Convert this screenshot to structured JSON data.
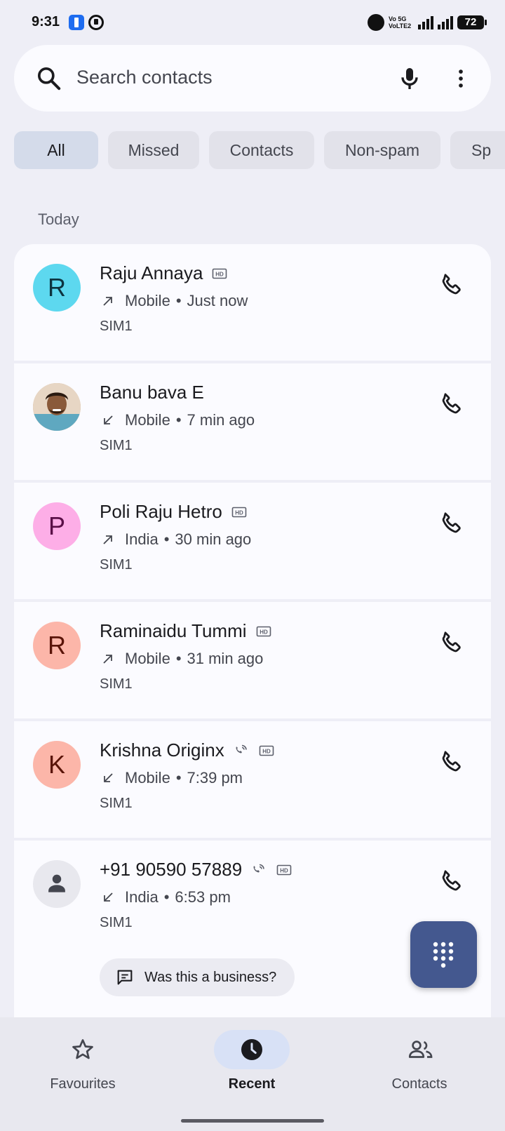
{
  "status_bar": {
    "time": "9:31",
    "network_label_top": "Vo 5G",
    "network_label_bottom": "VoLTE2",
    "battery": "72"
  },
  "search": {
    "placeholder": "Search contacts"
  },
  "filters": [
    {
      "label": "All",
      "active": true
    },
    {
      "label": "Missed",
      "active": false
    },
    {
      "label": "Contacts",
      "active": false
    },
    {
      "label": "Non-spam",
      "active": false
    },
    {
      "label": "Sp",
      "active": false
    }
  ],
  "section_title": "Today",
  "calls": [
    {
      "name": "Raju Annaya",
      "initial": "R",
      "avatar_color": "#5dd8ef",
      "initial_color": "#0d3440",
      "direction": "outgoing",
      "location": "Mobile",
      "time": "Just now",
      "sim": "SIM1",
      "hd": true,
      "wifi_call": false
    },
    {
      "name": "Banu bava E",
      "initial": "",
      "avatar_color": "#c9a27e",
      "initial_color": "#ffffff",
      "direction": "incoming",
      "location": "Mobile",
      "time": "7 min ago",
      "sim": "SIM1",
      "hd": false,
      "wifi_call": false,
      "photo": true
    },
    {
      "name": "Poli Raju Hetro",
      "initial": "P",
      "avatar_color": "#fdaee7",
      "initial_color": "#5a0f47",
      "direction": "outgoing",
      "location": "India",
      "time": "30 min ago",
      "sim": "SIM1",
      "hd": true,
      "wifi_call": false
    },
    {
      "name": "Raminaidu Tummi",
      "initial": "R",
      "avatar_color": "#fcb6a9",
      "initial_color": "#5a1408",
      "direction": "outgoing",
      "location": "Mobile",
      "time": "31 min ago",
      "sim": "SIM1",
      "hd": true,
      "wifi_call": false
    },
    {
      "name": "Krishna Originx",
      "initial": "K",
      "avatar_color": "#fcb6a9",
      "initial_color": "#5a1408",
      "direction": "incoming",
      "location": "Mobile",
      "time": "7:39 pm",
      "sim": "SIM1",
      "hd": true,
      "wifi_call": true
    },
    {
      "name": "+91 90590 57889",
      "initial": "",
      "avatar_color": "#e8e8ee",
      "initial_color": "#44464f",
      "direction": "incoming",
      "location": "India",
      "time": "6:53 pm",
      "sim": "SIM1",
      "hd": true,
      "wifi_call": true,
      "unknown": true
    }
  ],
  "business_prompt": "Was this a business?",
  "bottom_nav": [
    {
      "label": "Favourites",
      "icon": "star-icon",
      "active": false
    },
    {
      "label": "Recent",
      "icon": "clock-icon",
      "active": true
    },
    {
      "label": "Contacts",
      "icon": "people-icon",
      "active": false
    }
  ],
  "colors": {
    "background": "#eeeef6",
    "card": "#fbfbff",
    "accent": "#44588f",
    "active_chip": "#d4dbea"
  }
}
